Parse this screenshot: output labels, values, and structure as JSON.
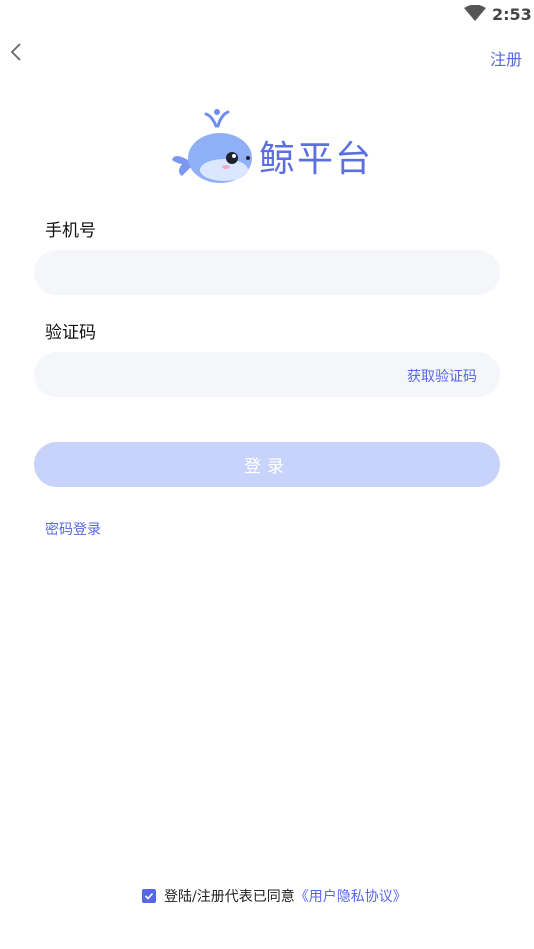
{
  "status": {
    "time": "2:53"
  },
  "header": {
    "register_label": "注册"
  },
  "brand": {
    "name": "鲸平台"
  },
  "form": {
    "phone_label": "手机号",
    "phone_value": "",
    "code_label": "验证码",
    "code_value": "",
    "get_code_label": "获取验证码",
    "login_label": "登录",
    "password_login_label": "密码登录"
  },
  "agreement": {
    "checked": true,
    "text": "登陆/注册代表已同意",
    "link_label": "《用户隐私协议》"
  },
  "colors": {
    "accent": "#5668e8",
    "button_disabled": "#c8d3fb",
    "field_bg": "#f5f6fa"
  }
}
